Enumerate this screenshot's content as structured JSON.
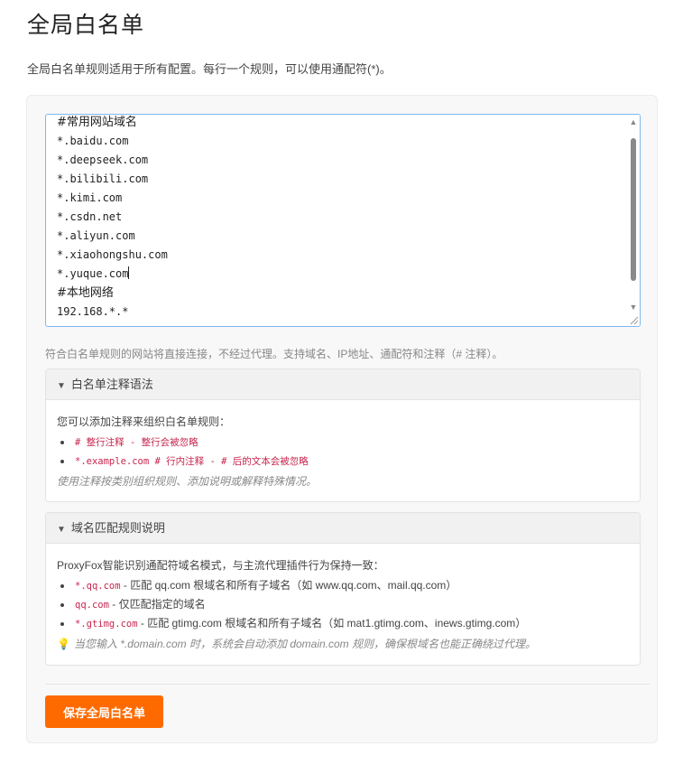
{
  "page": {
    "title": "全局白名单",
    "description": "全局白名单规则适用于所有配置。每行一个规则，可以使用通配符(*)。"
  },
  "editor": {
    "lines": [
      "#常用网站域名",
      "*.baidu.com",
      "*.deepseek.com",
      "*.bilibili.com",
      "*.kimi.com",
      "*.csdn.net",
      "*.aliyun.com",
      "*.xiaohongshu.com",
      "*.yuque.com",
      "#本地网络",
      "192.168.*.*"
    ]
  },
  "helper_text": "符合白名单规则的网站将直接连接，不经过代理。支持域名、IP地址、通配符和注释（# 注释）。",
  "comment_panel": {
    "title": "白名单注释语法",
    "intro": "您可以添加注释来组织白名单规则：",
    "items": [
      {
        "code": "# 整行注释 - 整行会被忽略"
      },
      {
        "code": "*.example.com # 行内注释 - # 后的文本会被忽略"
      }
    ],
    "note": "使用注释按类别组织规则、添加说明或解释特殊情况。"
  },
  "domain_panel": {
    "title": "域名匹配规则说明",
    "intro": "ProxyFox智能识别通配符域名模式，与主流代理插件行为保持一致：",
    "items": [
      {
        "code": "*.qq.com",
        "text": " - 匹配 qq.com 根域名和所有子域名（如 www.qq.com、mail.qq.com）"
      },
      {
        "code": "qq.com",
        "text": " - 仅匹配指定的域名"
      },
      {
        "code": "*.gtimg.com",
        "text": " - 匹配 gtimg.com 根域名和所有子域名（如 mat1.gtimg.com、inews.gtimg.com）"
      }
    ],
    "note": "当您输入 *.domain.com 时，系统会自动添加 domain.com 规则，确保根域名也能正确绕过代理。"
  },
  "save_button": "保存全局白名单",
  "colors": {
    "accent": "#ff6a00",
    "code": "#c7254e",
    "focus_border": "#7fb8f0"
  },
  "icons": {
    "collapse": "triangle-down-icon",
    "tip": "lightbulb-icon"
  }
}
